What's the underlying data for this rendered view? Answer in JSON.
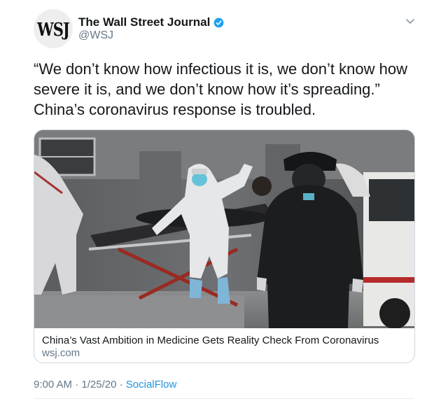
{
  "author": {
    "avatar_text": "WSJ",
    "name": "The Wall Street Journal",
    "handle": "@WSJ",
    "verified_color": "#1da1f2"
  },
  "tweet": {
    "text": "“We don’t know how infectious it is, we don’t know how severe it is, and we don’t know how it’s spreading.” China’s coronavirus response is troubled."
  },
  "card": {
    "title": "China’s Vast Ambition in Medicine Gets Reality Check From Coronavirus",
    "domain": "wsj.com"
  },
  "meta": {
    "time": "9:00 AM",
    "date": "1/25/20",
    "separator": "·",
    "source": "SocialFlow"
  },
  "icons": {
    "verified": "verified-badge-icon",
    "menu": "chevron-down-icon"
  },
  "colors": {
    "accent": "#1b95e0",
    "secondary_text": "#657786",
    "primary_text": "#14171a"
  }
}
